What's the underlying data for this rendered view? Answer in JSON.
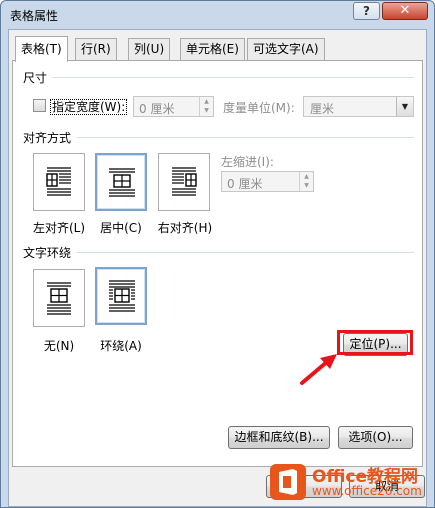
{
  "window": {
    "title": "表格属性"
  },
  "titlebar": {
    "help_label": "?",
    "close_label": "✕"
  },
  "tabs": [
    {
      "label": "表格(T)"
    },
    {
      "label": "行(R)"
    },
    {
      "label": "列(U)"
    },
    {
      "label": "单元格(E)"
    },
    {
      "label": "可选文字(A)"
    }
  ],
  "size": {
    "section_title": "尺寸",
    "preferred_width_label": "指定宽度(W):",
    "preferred_width_value": "0 厘米",
    "measure_in_label": "度量单位(M):",
    "measure_in_value": "厘米",
    "preferred_width_checked": false
  },
  "alignment": {
    "section_title": "对齐方式",
    "options": [
      {
        "label": "左对齐(L)",
        "selected": false
      },
      {
        "label": "居中(C)",
        "selected": true
      },
      {
        "label": "右对齐(H)",
        "selected": false
      }
    ],
    "indent_label": "左缩进(I):",
    "indent_value": "0 厘米"
  },
  "wrapping": {
    "section_title": "文字环绕",
    "options": [
      {
        "label": "无(N)",
        "selected": false
      },
      {
        "label": "环绕(A)",
        "selected": true
      }
    ],
    "positioning_button": "定位(P)..."
  },
  "footer": {
    "borders_button": "边框和底纹(B)...",
    "options_button": "选项(O)...",
    "cancel_button": "取消"
  },
  "watermark": {
    "brand": "Office教程网",
    "url": "www.office26.com"
  },
  "colors": {
    "highlight": "#e8141b",
    "watermark_orange": "#e8561b",
    "selection_border": "#7da2ce"
  }
}
